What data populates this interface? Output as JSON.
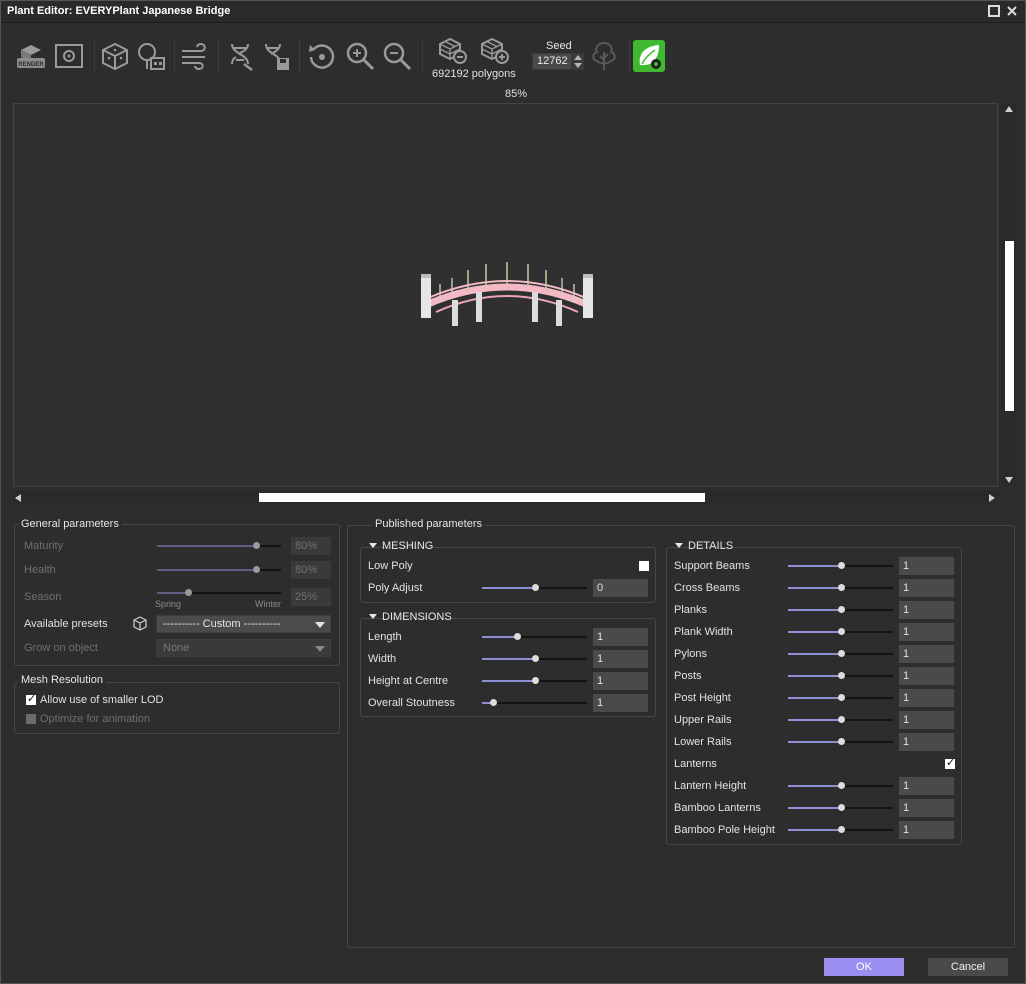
{
  "window": {
    "title": "Plant Editor:  EVERYPlant Japanese Bridge"
  },
  "toolbar": {
    "render_icon_text": "RENDER",
    "polygons": "692192 polygons",
    "zoom_percent": "85%",
    "seed_label": "Seed",
    "seed_value": "12762",
    "icons": [
      "render-icon",
      "settings-icon",
      "cube-icon",
      "building-icon",
      "wind-icon",
      "dna-icon",
      "dna-save-icon",
      "rotate-icon",
      "zoom-in-icon",
      "zoom-out-icon",
      "decrease-polygons-icon",
      "increase-polygons-icon",
      "tree-icon",
      "leaf-settings-icon"
    ]
  },
  "general": {
    "title": "General parameters",
    "maturity": {
      "label": "Maturity",
      "value": "80%",
      "level": 0.8
    },
    "health": {
      "label": "Health",
      "value": "80%",
      "level": 0.8
    },
    "season": {
      "label": "Season",
      "value": "25%",
      "level": 0.25,
      "min_label": "Spring",
      "max_label": "Winter"
    },
    "presets": {
      "label": "Available presets",
      "value": "---------- Custom ----------"
    },
    "grow": {
      "label": "Grow on object",
      "value": "None"
    }
  },
  "mesh": {
    "title": "Mesh Resolution",
    "smaller_lod": {
      "label": "Allow use of smaller LOD",
      "checked": true
    },
    "optimize": {
      "label": "Optimize for animation",
      "checked": false
    }
  },
  "published": {
    "title": "Published parameters",
    "meshing": {
      "title": "MESHING",
      "low_poly": {
        "label": "Low Poly",
        "checked": false
      },
      "poly_adjust": {
        "label": "Poly Adjust",
        "value": "0",
        "level": 0.5
      }
    },
    "dimensions": {
      "title": "DIMENSIONS",
      "rows": [
        {
          "label": "Length",
          "value": "1",
          "level": 0.33
        },
        {
          "label": "Width",
          "value": "1",
          "level": 0.5
        },
        {
          "label": "Height at Centre",
          "value": "1",
          "level": 0.5
        },
        {
          "label": "Overall Stoutness",
          "value": "1",
          "level": 0.1
        }
      ]
    },
    "details": {
      "title": "DETAILS",
      "rows": [
        {
          "label": "Support Beams",
          "value": "1",
          "level": 0.5
        },
        {
          "label": "Cross Beams",
          "value": "1",
          "level": 0.5
        },
        {
          "label": "Planks",
          "value": "1",
          "level": 0.5
        },
        {
          "label": "Plank Width",
          "value": "1",
          "level": 0.5
        },
        {
          "label": "Pylons",
          "value": "1",
          "level": 0.5
        },
        {
          "label": "Posts",
          "value": "1",
          "level": 0.5
        },
        {
          "label": "Post Height",
          "value": "1",
          "level": 0.5
        },
        {
          "label": "Upper Rails",
          "value": "1",
          "level": 0.5
        },
        {
          "label": "Lower Rails",
          "value": "1",
          "level": 0.5
        },
        {
          "label": "Lanterns",
          "checkbox": true,
          "checked": true
        },
        {
          "label": "Lantern Height",
          "value": "1",
          "level": 0.5
        },
        {
          "label": "Bamboo Lanterns",
          "value": "1",
          "level": 0.5
        },
        {
          "label": "Bamboo Pole Height",
          "value": "1",
          "level": 0.5
        }
      ]
    }
  },
  "footer": {
    "ok": "OK",
    "cancel": "Cancel"
  },
  "colors": {
    "accent": "#9a8ff0",
    "slider_fill": "#8f8fd6",
    "leaf_green": "#3fb92f",
    "bridge_pink": "#f4b9c4"
  }
}
